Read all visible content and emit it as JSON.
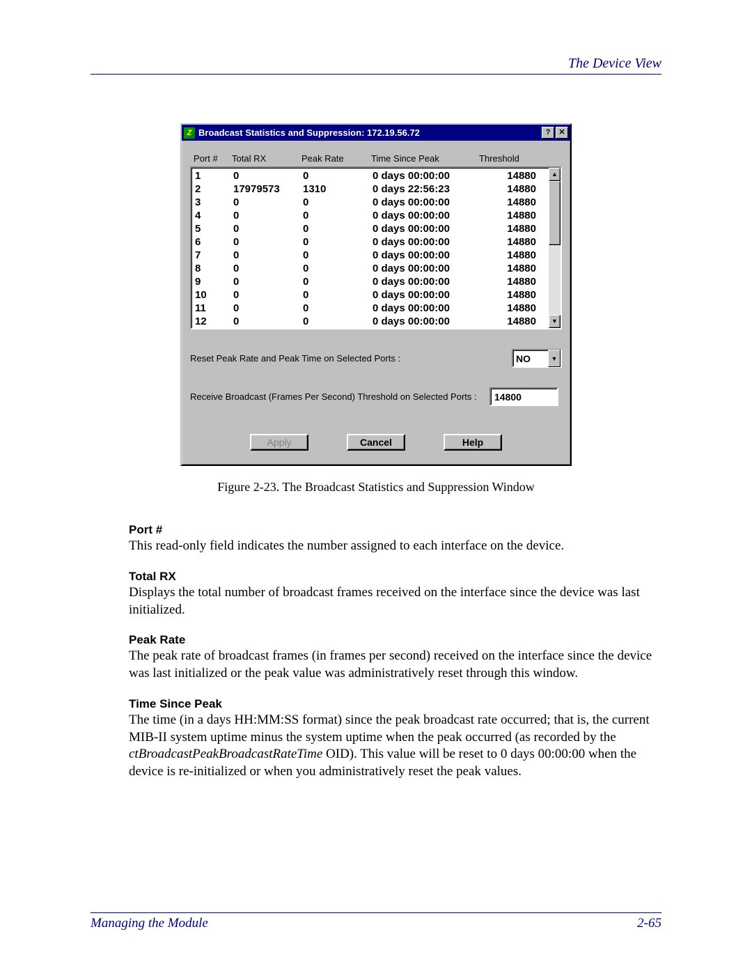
{
  "header": {
    "section": "The Device View"
  },
  "dialog": {
    "title": "Broadcast Statistics and Suppression: 172.19.56.72",
    "columns": {
      "port": "Port #",
      "total": "Total RX",
      "peak": "Peak Rate",
      "time": "Time Since Peak",
      "thresh": "Threshold"
    },
    "rows": [
      {
        "port": "1",
        "total": "0",
        "peak": "0",
        "time": "0 days 00:00:00",
        "thresh": "14880"
      },
      {
        "port": "2",
        "total": "17979573",
        "peak": "1310",
        "time": "0 days 22:56:23",
        "thresh": "14880"
      },
      {
        "port": "3",
        "total": "0",
        "peak": "0",
        "time": "0 days 00:00:00",
        "thresh": "14880"
      },
      {
        "port": "4",
        "total": "0",
        "peak": "0",
        "time": "0 days 00:00:00",
        "thresh": "14880"
      },
      {
        "port": "5",
        "total": "0",
        "peak": "0",
        "time": "0 days 00:00:00",
        "thresh": "14880"
      },
      {
        "port": "6",
        "total": "0",
        "peak": "0",
        "time": "0 days 00:00:00",
        "thresh": "14880"
      },
      {
        "port": "7",
        "total": "0",
        "peak": "0",
        "time": "0 days 00:00:00",
        "thresh": "14880"
      },
      {
        "port": "8",
        "total": "0",
        "peak": "0",
        "time": "0 days 00:00:00",
        "thresh": "14880"
      },
      {
        "port": "9",
        "total": "0",
        "peak": "0",
        "time": "0 days 00:00:00",
        "thresh": "14880"
      },
      {
        "port": "10",
        "total": "0",
        "peak": "0",
        "time": "0 days 00:00:00",
        "thresh": "14880"
      },
      {
        "port": "11",
        "total": "0",
        "peak": "0",
        "time": "0 days 00:00:00",
        "thresh": "14880"
      },
      {
        "port": "12",
        "total": "0",
        "peak": "0",
        "time": "0 days 00:00:00",
        "thresh": "14880"
      }
    ],
    "reset_label": "Reset Peak Rate and Peak Time on Selected Ports :",
    "reset_value": "NO",
    "threshold_label": "Receive Broadcast (Frames Per Second) Threshold on Selected Ports :",
    "threshold_value": "14800",
    "buttons": {
      "apply": "Apply",
      "cancel": "Cancel",
      "help": "Help"
    }
  },
  "caption": "Figure 2-23. The Broadcast Statistics and Suppression Window",
  "definitions": {
    "port_h": "Port #",
    "port_d": "This read-only field indicates the number assigned to each interface on the device.",
    "total_h": "Total RX",
    "total_d": "Displays the total number of broadcast frames received on the interface since the device was last initialized.",
    "peak_h": "Peak Rate",
    "peak_d": "The peak rate of broadcast frames (in frames per second) received on the interface since the device was last initialized or the peak value was administratively reset through this window.",
    "time_h": "Time Since Peak",
    "time_d1": "The time (in a days HH:MM:SS format) since the peak broadcast rate occurred; that is, the current MIB-II system uptime minus the system uptime when the peak occurred (as recorded by the ",
    "time_oid": "ctBroadcastPeakBroadcastRateTime",
    "time_d2": " OID). This value will be reset to 0 days 00:00:00 when the device is re-initialized or when you administratively reset the peak values."
  },
  "footer": {
    "left": "Managing the Module",
    "right": "2-65"
  }
}
